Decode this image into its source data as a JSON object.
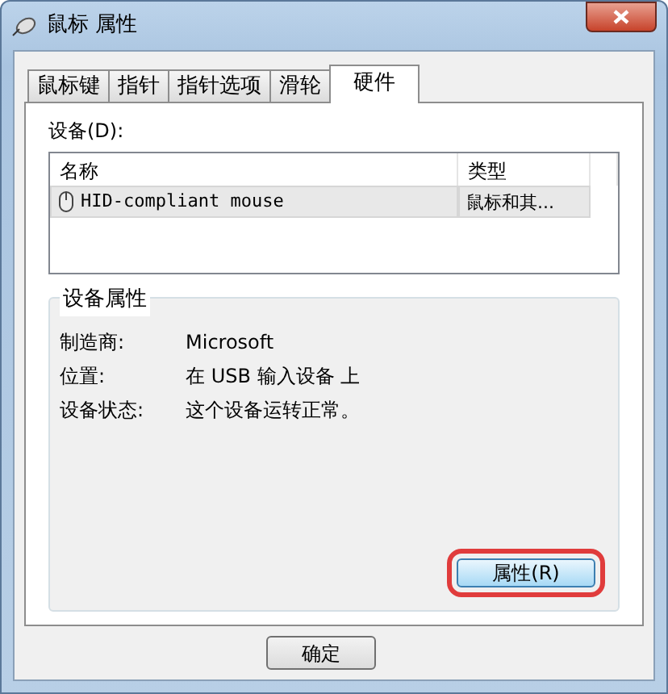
{
  "window": {
    "title": "鼠标 属性"
  },
  "tabs": [
    {
      "label": "鼠标键",
      "selected": false
    },
    {
      "label": "指针",
      "selected": false
    },
    {
      "label": "指针选项",
      "selected": false
    },
    {
      "label": "滑轮",
      "selected": false
    },
    {
      "label": "硬件",
      "selected": true
    }
  ],
  "devices": {
    "label": "设备(D):",
    "columns": [
      "名称",
      "类型"
    ],
    "rows": [
      {
        "name": "HID-compliant mouse",
        "type": "鼠标和其...",
        "selected": true
      }
    ]
  },
  "device_properties": {
    "title": "设备属性",
    "fields": [
      {
        "label": "制造商:",
        "value": "Microsoft"
      },
      {
        "label": "位置:",
        "value": "在 USB 输入设备 上"
      },
      {
        "label": "设备状态:",
        "value": "这个设备运转正常。"
      }
    ],
    "button": {
      "label": "属性(R)",
      "highlighted": true
    }
  },
  "footer_buttons": [
    "确定"
  ]
}
